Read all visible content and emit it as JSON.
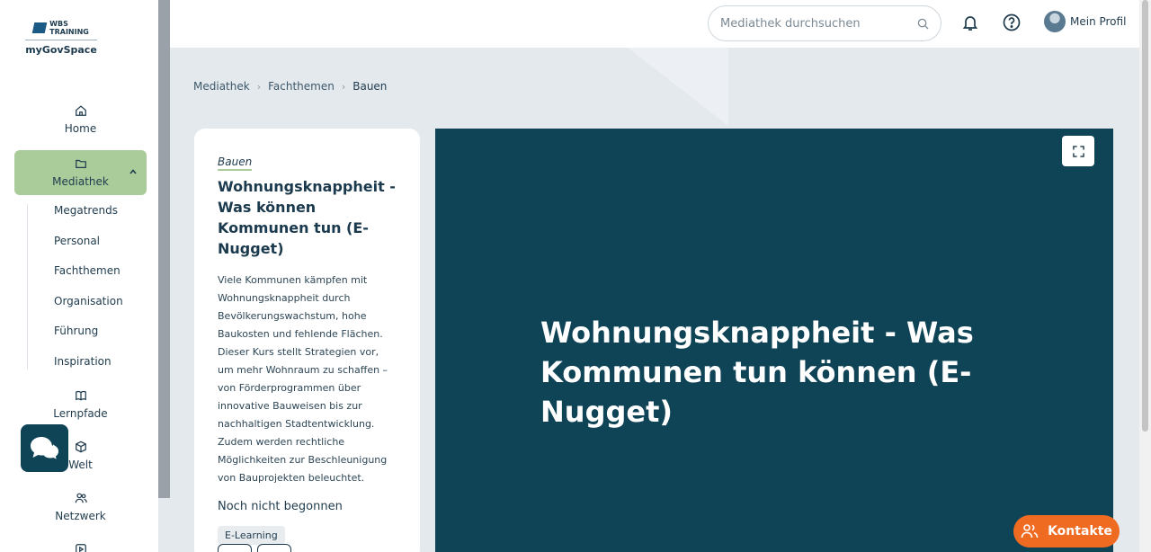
{
  "logo": {
    "brand_line1": "WBS",
    "brand_line2": "TRAINING",
    "product": "myGovSpace"
  },
  "sidebar": {
    "items": [
      {
        "label": "Home",
        "icon": "home-icon"
      },
      {
        "label": "Mediathek",
        "icon": "folder-icon"
      },
      {
        "label": "Lernpfade",
        "icon": "book-icon"
      },
      {
        "label": "Welt",
        "icon": "cube-icon"
      },
      {
        "label": "Netzwerk",
        "icon": "people-icon"
      }
    ],
    "subitems": [
      "Megatrends",
      "Personal",
      "Fachthemen",
      "Organisation",
      "Führung",
      "Inspiration"
    ]
  },
  "header": {
    "search_placeholder": "Mediathek durchsuchen",
    "profile_label": "Mein Profil"
  },
  "breadcrumb": [
    "Mediathek",
    "Fachthemen",
    "Bauen"
  ],
  "card": {
    "category": "Bauen",
    "title": "Wohnungsknappheit - Was können Kommunen tun (E-Nugget)",
    "description": "Viele Kommunen kämpfen mit Wohnungsknappheit durch Bevölkerungswachstum, hohe Baukosten und fehlende Flächen. Dieser Kurs stellt Strategien vor, um mehr Wohnraum zu schaffen – von Förderprogrammen über innovative Bauweisen bis zur nachhaltigen Stadtentwicklung. Zudem werden rechtliche Möglichkeiten zur Beschleunigung von Bauprojekten beleuchtet.",
    "status": "Noch nicht begonnen",
    "tag": "E-Learning"
  },
  "player": {
    "title": "Wohnungsknappheit - Was Kommunen tun können (E-Nugget)"
  },
  "contacts": {
    "label": "Kontakte"
  },
  "colors": {
    "accent_green": "#a9cc9a",
    "player_bg": "#0f4457",
    "contacts_orange": "#f06b22"
  }
}
